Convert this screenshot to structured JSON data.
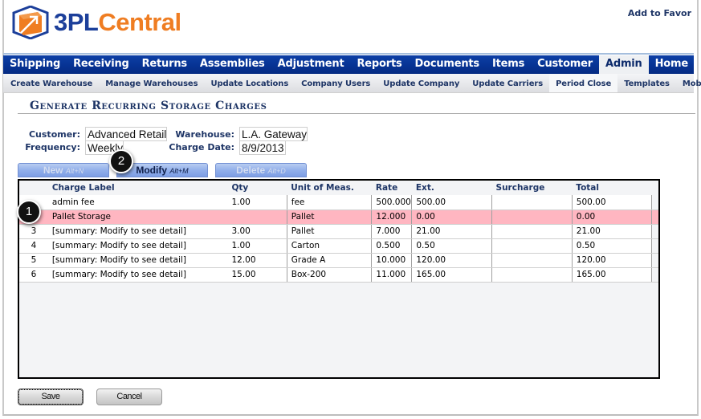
{
  "brand": {
    "logo_part1": "3PL",
    "logo_part2": "Central",
    "primary_color": "#1c3f9a",
    "accent_color": "#ef7d22"
  },
  "header": {
    "add_to_favorites": "Add to Favor"
  },
  "topnav": {
    "items": [
      {
        "label": "Shipping",
        "active": false
      },
      {
        "label": "Receiving",
        "active": false
      },
      {
        "label": "Returns",
        "active": false
      },
      {
        "label": "Assemblies",
        "active": false
      },
      {
        "label": "Adjustment",
        "active": false
      },
      {
        "label": "Reports",
        "active": false
      },
      {
        "label": "Documents",
        "active": false
      },
      {
        "label": "Items",
        "active": false
      },
      {
        "label": "Customer",
        "active": false
      },
      {
        "label": "Admin",
        "active": true
      },
      {
        "label": "Home",
        "active": false
      }
    ]
  },
  "subnav": {
    "items": [
      {
        "label": "Create Warehouse",
        "active": false
      },
      {
        "label": "Manage Warehouses",
        "active": false
      },
      {
        "label": "Update Locations",
        "active": false
      },
      {
        "label": "Company Users",
        "active": false
      },
      {
        "label": "Update Company",
        "active": false
      },
      {
        "label": "Update Carriers",
        "active": false
      },
      {
        "label": "Period Close",
        "active": true
      },
      {
        "label": "Templates",
        "active": false
      },
      {
        "label": "Mobile",
        "active": false
      }
    ]
  },
  "page": {
    "title": "Generate Recurring Storage Charges"
  },
  "form": {
    "customer_label": "Customer:",
    "customer_value": "Advanced Retail",
    "warehouse_label": "Warehouse:",
    "warehouse_value": "L.A. Gateway",
    "frequency_label": "Frequency:",
    "frequency_value": "Weekly",
    "charge_date_label": "Charge Date:",
    "charge_date_value": "8/9/2013"
  },
  "actions": {
    "new": {
      "label": "New",
      "hotkey": "Alt+N",
      "enabled": false
    },
    "modify": {
      "label": "Modify",
      "hotkey": "Alt+M",
      "enabled": true
    },
    "delete": {
      "label": "Delete",
      "hotkey": "Alt+D",
      "enabled": false
    }
  },
  "grid": {
    "columns": [
      "",
      "Charge Label",
      "Qty",
      "Unit of Meas.",
      "Rate",
      "Ext.",
      "Surcharge",
      "Total"
    ],
    "rows": [
      {
        "num": "",
        "label": "admin fee",
        "qty": "1.00",
        "uom": "fee",
        "rate": "500.000",
        "ext": "500.00",
        "surcharge": "",
        "total": "500.00",
        "selected": false
      },
      {
        "num": "",
        "label": "Pallet Storage",
        "qty": "",
        "uom": "Pallet",
        "rate": "12.000",
        "ext": "0.00",
        "surcharge": "",
        "total": "0.00",
        "selected": true
      },
      {
        "num": "3",
        "label": "[summary: Modify to see detail]",
        "qty": "3.00",
        "uom": "Pallet",
        "rate": "7.000",
        "ext": "21.00",
        "surcharge": "",
        "total": "21.00",
        "selected": false
      },
      {
        "num": "4",
        "label": "[summary: Modify to see detail]",
        "qty": "1.00",
        "uom": "Carton",
        "rate": "0.500",
        "ext": "0.50",
        "surcharge": "",
        "total": "0.50",
        "selected": false
      },
      {
        "num": "5",
        "label": "[summary: Modify to see detail]",
        "qty": "12.00",
        "uom": "Grade A",
        "rate": "10.000",
        "ext": "120.00",
        "surcharge": "",
        "total": "120.00",
        "selected": false
      },
      {
        "num": "6",
        "label": "[summary: Modify to see detail]",
        "qty": "15.00",
        "uom": "Box-200",
        "rate": "11.000",
        "ext": "165.00",
        "surcharge": "",
        "total": "165.00",
        "selected": false
      }
    ],
    "selected_row_color": "#ffb6c1"
  },
  "callouts": {
    "one": "1",
    "two": "2"
  },
  "footer": {
    "save_label": "Save",
    "cancel_label": "Cancel"
  }
}
